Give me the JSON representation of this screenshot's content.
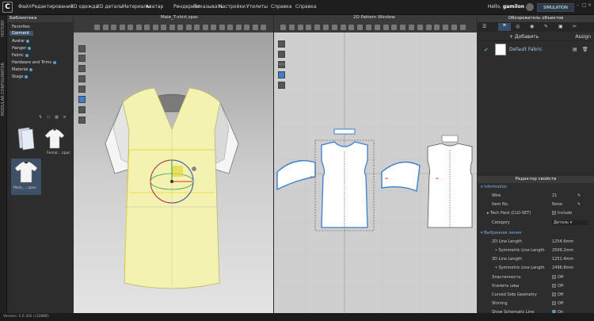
{
  "app": {
    "logo": "C",
    "hello_prefix": "Hello,",
    "user": "gamilon",
    "mode": "SIMULATION"
  },
  "menu": [
    "Файл",
    "Редактирование",
    "3D одежда",
    "2D деталь",
    "Материалы",
    "Аватар",
    "Рендеринг",
    "Показывать",
    "Настройки",
    "Утилиты",
    "Справка"
  ],
  "side_tabs": [
    "HISTORY",
    "MODULAR CONFIGURATOR"
  ],
  "library": {
    "title": "Библиотека",
    "tree": [
      {
        "label": "Favorites",
        "dot": false
      },
      {
        "label": "Garment",
        "dot": false,
        "selected": true
      },
      {
        "label": "Avatar",
        "dot": true
      },
      {
        "label": "Hanger",
        "dot": true
      },
      {
        "label": "Fabric",
        "dot": true
      },
      {
        "label": "Hardware and Trims",
        "dot": true
      },
      {
        "label": "Material",
        "dot": true
      },
      {
        "label": "Stage",
        "dot": true
      }
    ],
    "thumbs": [
      {
        "label": ""
      },
      {
        "label": "Femal....zpac"
      },
      {
        "label": "Male_....zpac"
      }
    ]
  },
  "view3d": {
    "title": "Male_T-shirt.zpac"
  },
  "view2d": {
    "title": "2D Pattern Window"
  },
  "object_browser": {
    "title": "Обозреватель объектов",
    "add_label": "+ Добавить",
    "assign_label": "Assign",
    "fabric_name": "Default Fabric"
  },
  "properties": {
    "title": "Редактор свойств",
    "rows": [
      {
        "key": "Information",
        "value": "",
        "type": "section"
      },
      {
        "key": "Wire",
        "value": "21",
        "type": "text"
      },
      {
        "key": "Item No.",
        "value": "None",
        "type": "text"
      },
      {
        "key": "Tech Pack (CLO-SET)",
        "value": "Include",
        "type": "check"
      },
      {
        "key": "Category",
        "value": "Деталь",
        "type": "select"
      },
      {
        "key": "Выбранная линия",
        "value": "",
        "type": "section"
      },
      {
        "key": "2D Line Length",
        "value": "1254.6mm",
        "type": "text"
      },
      {
        "key": "Symmetric Line Length",
        "value": "2509.2mm",
        "type": "text"
      },
      {
        "key": "3D Line Length",
        "value": "1251.4mm",
        "type": "text"
      },
      {
        "key": "Symmetric Line Length",
        "value": "2496.8mm",
        "type": "text"
      },
      {
        "key": "Эластичность",
        "value": "Off",
        "type": "check"
      },
      {
        "key": "Усилить швы",
        "value": "Off",
        "type": "check"
      },
      {
        "key": "Curved Side Geometry",
        "value": "Off",
        "type": "check"
      },
      {
        "key": "Shirring",
        "value": "Off",
        "type": "check"
      },
      {
        "key": "Show Schematic Line",
        "value": "On",
        "type": "check"
      }
    ]
  },
  "status": {
    "text": "Version: 5.0.302 (r32886)"
  },
  "colors": {
    "accent": "#4aa3df",
    "garment": "#f3f2b0",
    "pattern_outline": "#3a7fd0"
  }
}
